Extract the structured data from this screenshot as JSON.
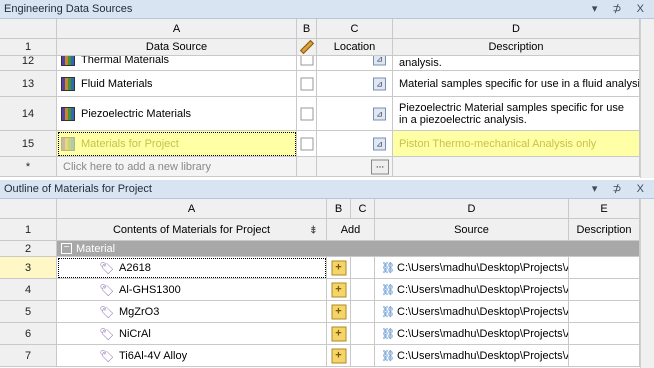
{
  "top_panel": {
    "title": "Engineering Data Sources",
    "controls": "▾ ⊅ X",
    "columns": [
      "A",
      "B",
      "C",
      "D"
    ],
    "header_row": {
      "num": "1",
      "a": "Data Source",
      "c": "Location",
      "d": "Description"
    },
    "rows": [
      {
        "num": "12",
        "name": "Thermal Materials",
        "desc": "analysis."
      },
      {
        "num": "13",
        "name": "Fluid Materials",
        "desc": "Material samples specific for use in a fluid analysis."
      },
      {
        "num": "14",
        "name": "Piezoelectric Materials",
        "desc": "Piezoelectric Material samples specific for use in a piezoelectric analysis."
      },
      {
        "num": "15",
        "name": "Materials for Project",
        "desc": "Piston Thermo-mechanical Analysis only"
      }
    ],
    "add_row": {
      "num": "*",
      "text": "Click here to add a new library",
      "button": "..."
    }
  },
  "bottom_panel": {
    "title": "Outline of Materials for Project",
    "controls": "▾ ⊅ X",
    "columns": [
      "A",
      "B",
      "C",
      "D",
      "E"
    ],
    "header_row": {
      "num": "1",
      "a": "Contents of Materials for Project",
      "b": "Add",
      "d": "Source",
      "e": "Description"
    },
    "group_row": {
      "num": "2",
      "label": "Material"
    },
    "rows": [
      {
        "num": "3",
        "name": "A2618",
        "source": "C:\\Users\\madhu\\Desktop\\Projects\\AN"
      },
      {
        "num": "4",
        "name": "Al-GHS1300",
        "source": "C:\\Users\\madhu\\Desktop\\Projects\\AN"
      },
      {
        "num": "5",
        "name": "MgZrO3",
        "source": "C:\\Users\\madhu\\Desktop\\Projects\\AN"
      },
      {
        "num": "6",
        "name": "NiCrAl",
        "source": "C:\\Users\\madhu\\Desktop\\Projects\\AN"
      },
      {
        "num": "7",
        "name": "Ti6Al-4V Alloy",
        "source": "C:\\Users\\madhu\\Desktop\\Projects\\AN"
      }
    ]
  }
}
